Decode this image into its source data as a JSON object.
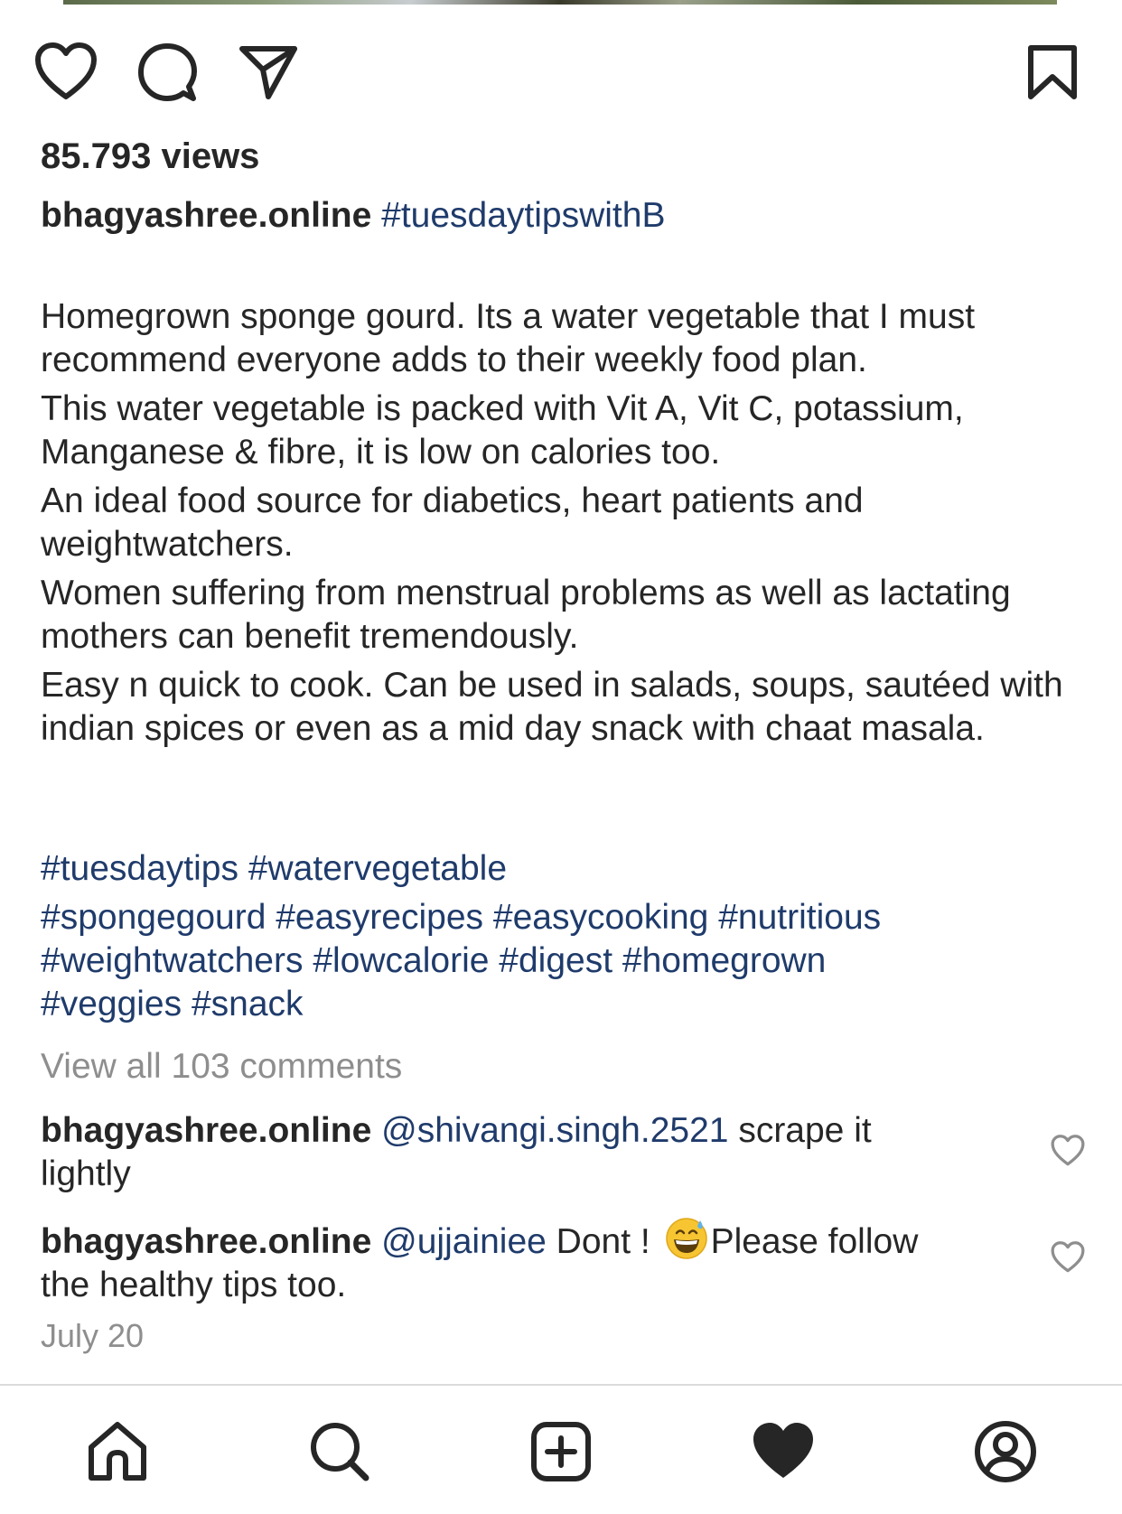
{
  "post": {
    "views": "85.793 views",
    "author": "bhagyashree.online",
    "caption_hashtag": "#tuesdaytipswithB",
    "paragraphs": [
      "Homegrown sponge gourd. Its a water vegetable that I must recommend everyone adds to their weekly food plan.",
      "This water vegetable is packed with Vit A, Vit C, potassium, Manganese & fibre, it is low on calories too.",
      "An ideal food source for diabetics, heart patients and weightwatchers.",
      "Women suffering from menstrual problems as well as lactating mothers can benefit tremendously.",
      "Easy n quick to cook. Can be used in salads, soups, sautéed with indian spices or even as a mid day snack with chaat masala."
    ],
    "hashtags": [
      "#tuesdaytips",
      "#watervegetable",
      "#spongegourd",
      "#easyrecipes",
      "#easycooking",
      "#nutritious",
      "#weightwatchers",
      "#lowcalorie",
      "#digest",
      "#homegrown",
      "#veggies",
      "#snack"
    ],
    "view_all_comments": "View all 103 comments",
    "date": "July 20"
  },
  "comments": [
    {
      "user": "bhagyashree.online",
      "mention": "@shivangi.singh.2521",
      "text_line1": " scrape it",
      "text_line2": "lightly"
    },
    {
      "user": "bhagyashree.online",
      "mention": "@ujjainiee",
      "text_before_emoji": " Dont ! ",
      "emoji": "grinning-face-with-sweat",
      "text_after_emoji": "Please follow",
      "text_line2": "the healthy tips too."
    }
  ],
  "actions": {
    "icons": [
      "heart-icon",
      "comment-icon",
      "share-icon",
      "bookmark-icon"
    ]
  },
  "tabbar": {
    "icons": [
      "home-icon",
      "search-icon",
      "new-post-icon",
      "activity-heart-icon",
      "profile-icon"
    ]
  },
  "colors": {
    "text": "#262626",
    "link": "#1f3b6b",
    "muted": "#8e8e8e",
    "divider": "#dbdbdb"
  }
}
